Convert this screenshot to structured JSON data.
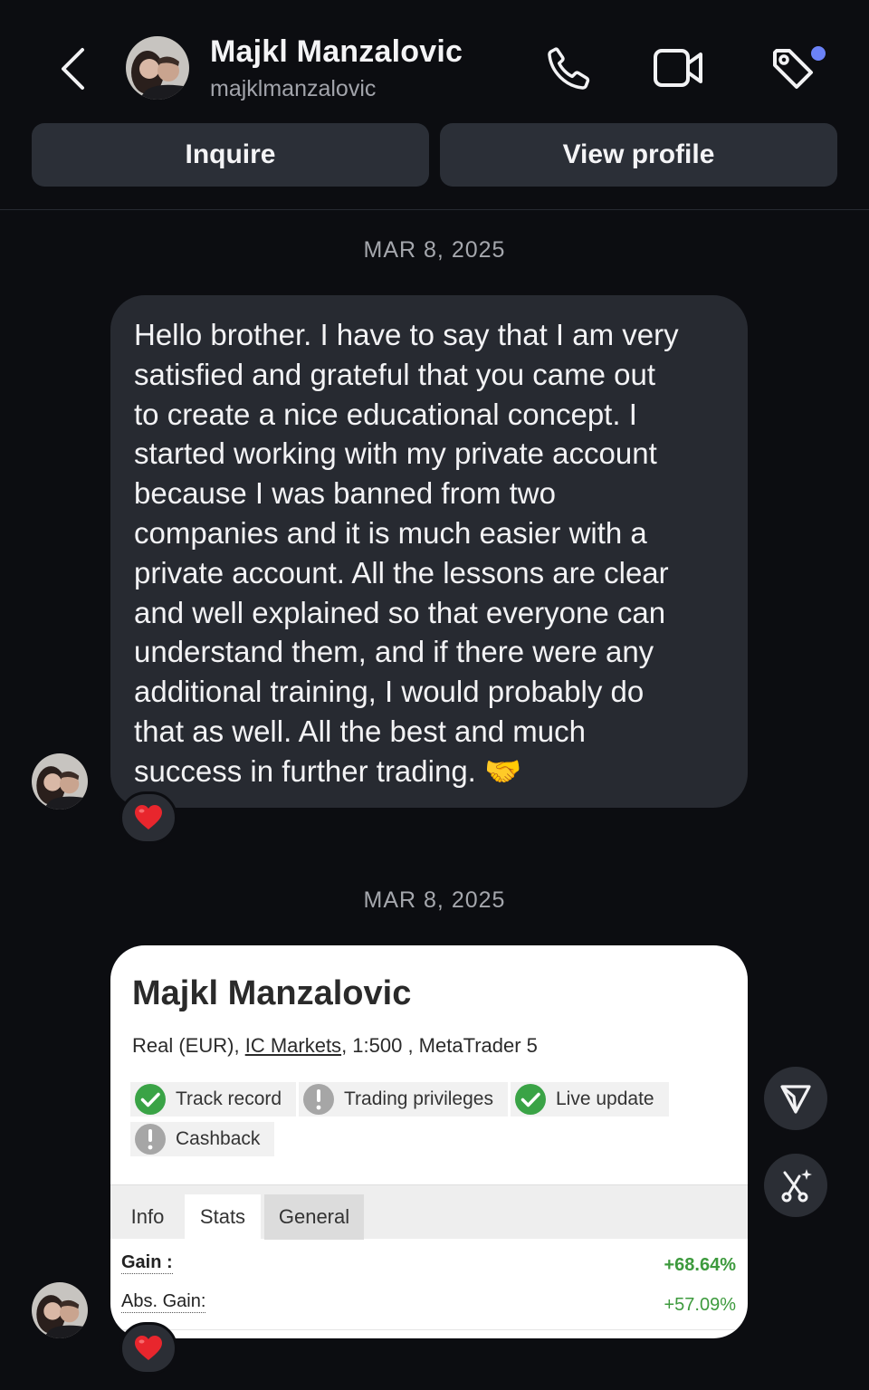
{
  "header": {
    "name": "Majkl Manzalovic",
    "handle": "majklmanzalovic",
    "back_icon": "chevron-left-icon",
    "call_icon": "phone-icon",
    "video_icon": "video-camera-icon",
    "tag_icon": "tag-icon",
    "notification_dot_color": "#6b82f7"
  },
  "actions": {
    "inquire": "Inquire",
    "view_profile": "View profile"
  },
  "messages": [
    {
      "date": "MAR 8, 2025",
      "text": "Hello brother. I have to say that I am very\nsatisfied and grateful that you came out\nto create a nice educational concept. I\nstarted working with my private account\nbecause I was banned from two\ncompanies and it is much easier with a\nprivate account. All the lessons are clear\nand well explained so that everyone can\nunderstand them, and if there were any\nadditional training, I would probably do\nthat as well. All the best and much\nsuccess in further trading. 🤝",
      "reaction": "❤️"
    },
    {
      "date": "MAR 8, 2025",
      "reaction": "❤️",
      "card": {
        "title": "Majkl Manzalovic",
        "meta_prefix": "Real (EUR),",
        "broker": "IC Markets",
        "meta_suffix": ", 1:500 , MetaTrader 5",
        "badges": [
          {
            "label": "Track record",
            "status": "verified"
          },
          {
            "label": "Trading privileges",
            "status": "warning"
          },
          {
            "label": "Live update",
            "status": "verified"
          },
          {
            "label": "Cashback",
            "status": "warning"
          }
        ],
        "tabs": [
          "Info",
          "Stats",
          "General"
        ],
        "stats": [
          {
            "label": "Gain :",
            "value": "+68.64%"
          },
          {
            "label": "Abs. Gain:",
            "value": "+57.09%"
          }
        ]
      }
    }
  ],
  "side_buttons": {
    "send_icon": "send-icon",
    "ai_icon": "ai-sparkle-icon"
  },
  "colors": {
    "background": "#0c0d11",
    "bubble": "#272a31",
    "button": "#2b2f37",
    "positive": "#3d9a3d",
    "verified": "#3aa346",
    "warning": "#a6a6a6"
  }
}
